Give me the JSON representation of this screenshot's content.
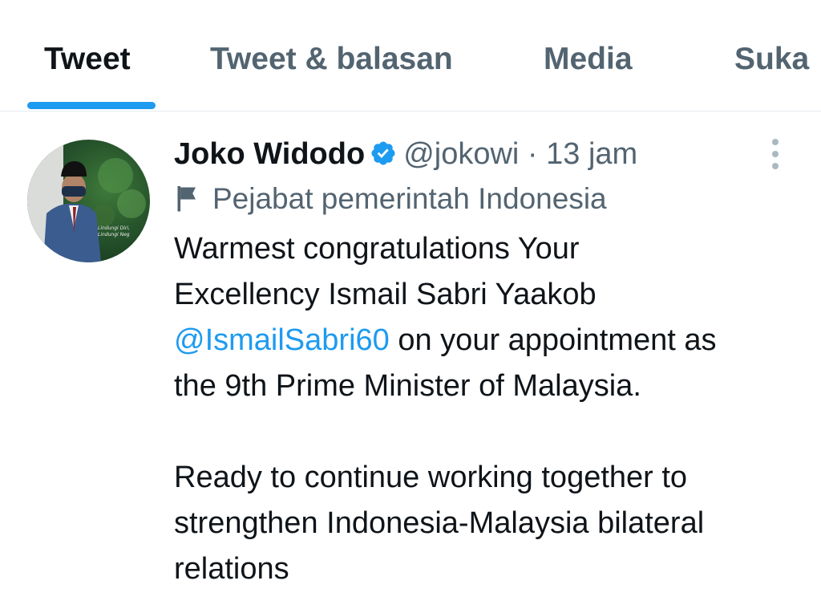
{
  "tabs": [
    {
      "label": "Tweet",
      "active": true
    },
    {
      "label": "Tweet & balasan",
      "active": false
    },
    {
      "label": "Media",
      "active": false
    },
    {
      "label": "Suka",
      "active": false
    }
  ],
  "tweet": {
    "author_name": "Joko Widodo",
    "handle": "@jokowi",
    "separator": "·",
    "time": "13 jam",
    "label": "Pejabat pemerintah Indonesia",
    "avatar_caption": [
      "Lindungi Diri,",
      "Lindungi Neg"
    ],
    "text": {
      "line1": "Warmest congratulations Your",
      "line2": "Excellency Ismail Sabri Yaakob",
      "mention": "@IsmailSabri60",
      "line3_rest": " on your appointment as",
      "line4": "the 9th Prime Minister of Malaysia.",
      "para2": "Ready to continue working together to strengthen Indonesia-Malaysia bilateral relations"
    }
  },
  "colors": {
    "accent": "#1d9bf0",
    "secondary_text": "#536471",
    "primary_text": "#0f1419"
  },
  "icons": [
    "verified-badge-icon",
    "more-options-icon",
    "flag-icon"
  ]
}
